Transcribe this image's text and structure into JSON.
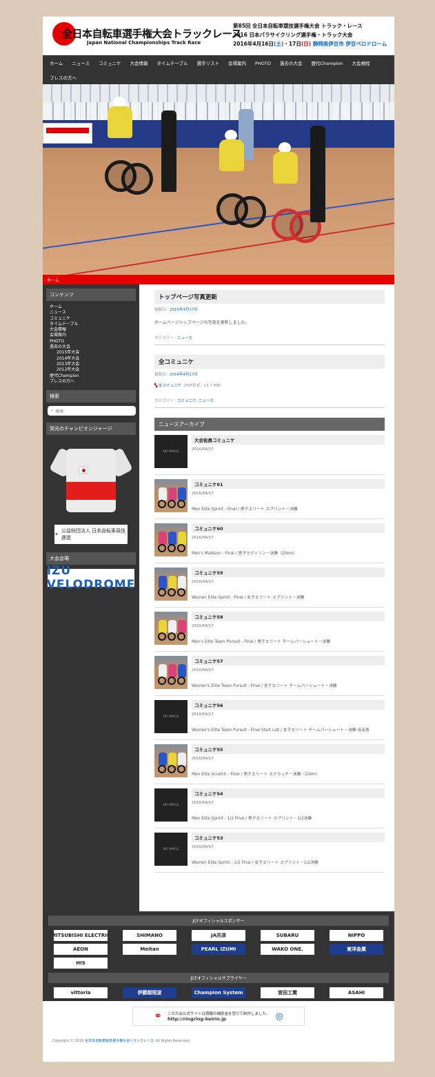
{
  "header": {
    "logo_jp": "全日本自転車選手権大会トラックレース",
    "logo_en": "Japan National Championships Track Race",
    "event_line1": "第85回 全日本自転車競技選手権大会 トラック・レース",
    "event_line2": "2016 日本パラサイクリング選手権・トラック大会",
    "event_date_prefix": "2016年4月16日",
    "event_day1": "(土)",
    "event_date_mid": "・17日",
    "event_day2": "(日)",
    "event_link": "静岡県伊豆市 伊豆ベロドローム"
  },
  "nav": [
    "ホーム",
    "ニュース",
    "コミュニケ",
    "大会情報",
    "タイムテーブル",
    "選手リスト",
    "会場案内",
    "PHOTO",
    "過去の大会",
    "歴代Champion",
    "大会規程",
    "プレスの方へ"
  ],
  "breadcrumb": "ホーム",
  "sidebar": {
    "contents_heading": "コンテンツ",
    "menu": [
      {
        "label": "ホーム",
        "sub": false
      },
      {
        "label": "ニュース",
        "sub": false
      },
      {
        "label": "コミュニケ",
        "sub": false
      },
      {
        "label": "タイムテーブル",
        "sub": false
      },
      {
        "label": "大会情報",
        "sub": false
      },
      {
        "label": "会場案内",
        "sub": false
      },
      {
        "label": "PHOTO",
        "sub": false
      },
      {
        "label": "過去の大会",
        "sub": false
      },
      {
        "label": "2015年大会",
        "sub": true
      },
      {
        "label": "2014年大会",
        "sub": true
      },
      {
        "label": "2013年大会",
        "sub": true
      },
      {
        "label": "2012年大会",
        "sub": true
      },
      {
        "label": "歴代Champion",
        "sub": false
      },
      {
        "label": "プレスの方へ",
        "sub": false
      }
    ],
    "search_heading": "検索",
    "search_placeholder": "検索",
    "champion_heading": "栄光のチャンピオンジャージ",
    "jcf_label": "公益財団法人 日本自転車競技連盟",
    "venue_heading": "大会会場",
    "venue_logo": "IZU VELODROME"
  },
  "posts": [
    {
      "title": "トップページ写真更新",
      "meta_label": "投稿日：",
      "meta_date": "2016年4月17日",
      "text": "ホームページトップページの写真を更新しました。",
      "cat_label": "カテゴリー：",
      "cat": "ニュース"
    },
    {
      "title": "全コミュニケ",
      "meta_label": "投稿日：",
      "meta_date": "2016年4月17日",
      "pdf_link": "全コミュニケ",
      "pdf_size": "（PDF形式：13.7 MB）",
      "cat_label": "カテゴリー：",
      "cat": "コミュニケ, ニュース"
    }
  ],
  "archive": {
    "heading": "ニュースアーカイブ",
    "no_image": "NO IMAGE",
    "items": [
      {
        "title": "大会役員コミュニケ",
        "date": "2016/04/17",
        "text": "",
        "photo": false
      },
      {
        "title": "コミュニケ61",
        "date": "2016/04/17",
        "text": "Men Elite Sprint - Final / 男子エリート スプリント－決勝",
        "photo": true
      },
      {
        "title": "コミュニケ60",
        "date": "2016/04/17",
        "text": "Men's Madison - Final / 男子マディソン－決勝（25km）",
        "photo": true
      },
      {
        "title": "コミュニケ59",
        "date": "2016/04/17",
        "text": "Women Elite Sprint - Final / 女子エリート スプリント－決勝",
        "photo": true
      },
      {
        "title": "コミュニケ58",
        "date": "2016/04/17",
        "text": "Men's Elite Team Pursuit - Final / 男子エリート チームパーシュート－決勝",
        "photo": true
      },
      {
        "title": "コミュニケ57",
        "date": "2016/04/17",
        "text": "Women's Elite Team Pursuit - Final / 女子エリート チームパーシュート－決勝",
        "photo": true
      },
      {
        "title": "コミュニケ56",
        "date": "2016/04/17",
        "text": "Women's Elite Team Pursuit - Final Start List / 女子エリート チームパーシュート－決勝 出走表",
        "photo": false
      },
      {
        "title": "コミュニケ55",
        "date": "2016/04/17",
        "text": "Men Elite Scratch - Final / 男子エリート スクラッチ－決勝（15km）",
        "photo": true
      },
      {
        "title": "コミュニケ54",
        "date": "2016/04/17",
        "text": "Men Elite Sprint - 1/2 Final / 男子エリート スプリント－1/2決勝",
        "photo": false
      },
      {
        "title": "コミュニケ53",
        "date": "2016/04/17",
        "text": "Women Elite Sprint - 1/2 Final / 女子エリート スプリント－1/2決勝",
        "photo": false
      }
    ]
  },
  "sponsors": {
    "heading": "JCFオフィシャルスポンサー",
    "logos": [
      "MITSUBISHI ELECTRIC",
      "SHIMANO",
      "JA共済",
      "SUBARU",
      "NIPPO",
      "AEON",
      "Meitan",
      "PEARL IZUMI",
      "WAKO ONE.",
      "東洋金属",
      "HIS"
    ],
    "supplier_heading": "JCFオフィシャルサプライヤー",
    "suppliers": [
      "vittoria",
      "伊藤超短波",
      "Champion System",
      "宮田工業",
      "ASAHI"
    ]
  },
  "footer": {
    "ringring_text": "この大会公式サイトは競輪の補助金を受けて制作しました。",
    "ringring_url": "http://ringring-keirin.jp",
    "copyright_prefix": "Copyright © 2016",
    "copyright_owner": "全日本自転車競技選手権大会トラックレース",
    "copyright_suffix": ". All Rights Reserved."
  },
  "colors": {
    "accent_red": "#e50000",
    "sidebar": "#333333",
    "link_blue": "#0066cc"
  }
}
